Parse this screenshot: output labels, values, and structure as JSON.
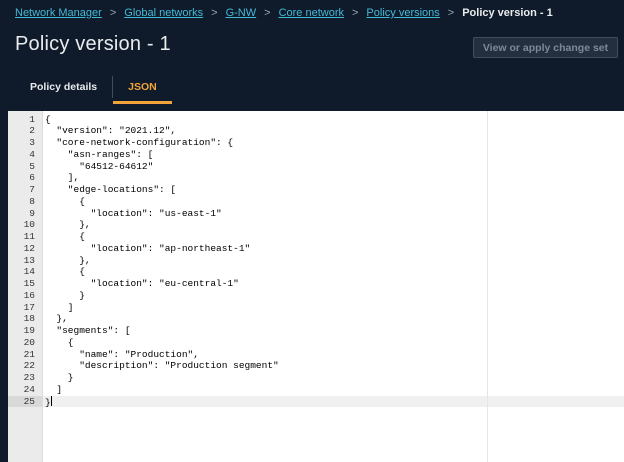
{
  "breadcrumb": {
    "items": [
      "Network Manager",
      "Global networks",
      "G-NW",
      "Core network",
      "Policy versions"
    ],
    "current": "Policy version - 1",
    "separator": ">"
  },
  "page": {
    "title": "Policy version - 1",
    "action_button": "View or apply change set"
  },
  "tabs": [
    {
      "label": "Policy details",
      "active": false
    },
    {
      "label": "JSON",
      "active": true
    }
  ],
  "editor": {
    "active_line": 25,
    "lines": [
      "{",
      "  \"version\": \"2021.12\",",
      "  \"core-network-configuration\": {",
      "    \"asn-ranges\": [",
      "      \"64512-64612\"",
      "    ],",
      "    \"edge-locations\": [",
      "      {",
      "        \"location\": \"us-east-1\"",
      "      },",
      "      {",
      "        \"location\": \"ap-northeast-1\"",
      "      },",
      "      {",
      "        \"location\": \"eu-central-1\"",
      "      }",
      "    ]",
      "  },",
      "  \"segments\": [",
      "    {",
      "      \"name\": \"Production\",",
      "      \"description\": \"Production segment\"",
      "    }",
      "  ]",
      "}"
    ]
  },
  "colors": {
    "background": "#0f1b2a",
    "link": "#44b9d6",
    "active_tab": "#f2a33a"
  }
}
